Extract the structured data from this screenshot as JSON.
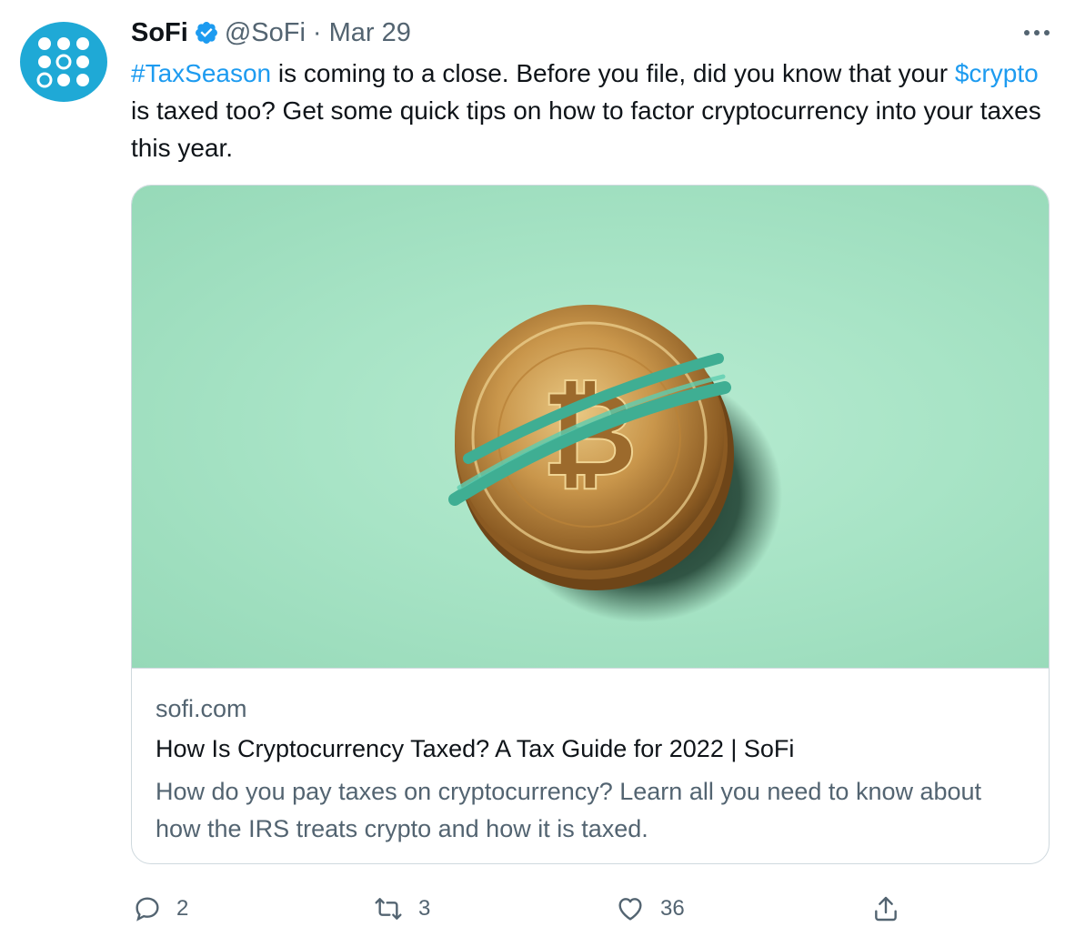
{
  "author": {
    "name": "SoFi",
    "handle": "@SoFi",
    "separator": "·",
    "date": "Mar 29",
    "verified": true
  },
  "tweet": {
    "hashtag": "#TaxSeason",
    "text_part1": " is coming to a close. Before you file, did you know that your ",
    "cashtag": "$crypto",
    "text_part2": " is taxed too? Get some quick tips on how to factor cryptocurrency into your taxes this year."
  },
  "card": {
    "domain": "sofi.com",
    "title": "How Is Cryptocurrency Taxed? A Tax Guide for 2022 | SoFi",
    "description": "How do you pay taxes on cryptocurrency? Learn all you need to know about how the IRS treats crypto and how it is taxed.",
    "image_subject": "bitcoin-coins-with-rubber-band"
  },
  "actions": {
    "reply_count": "2",
    "retweet_count": "3",
    "like_count": "36"
  },
  "colors": {
    "link": "#1d9bf0",
    "secondary_text": "#536471",
    "avatar_bg": "#1fa9d6",
    "verified": "#1d9bf0",
    "card_bg": "#a8e4c6"
  }
}
